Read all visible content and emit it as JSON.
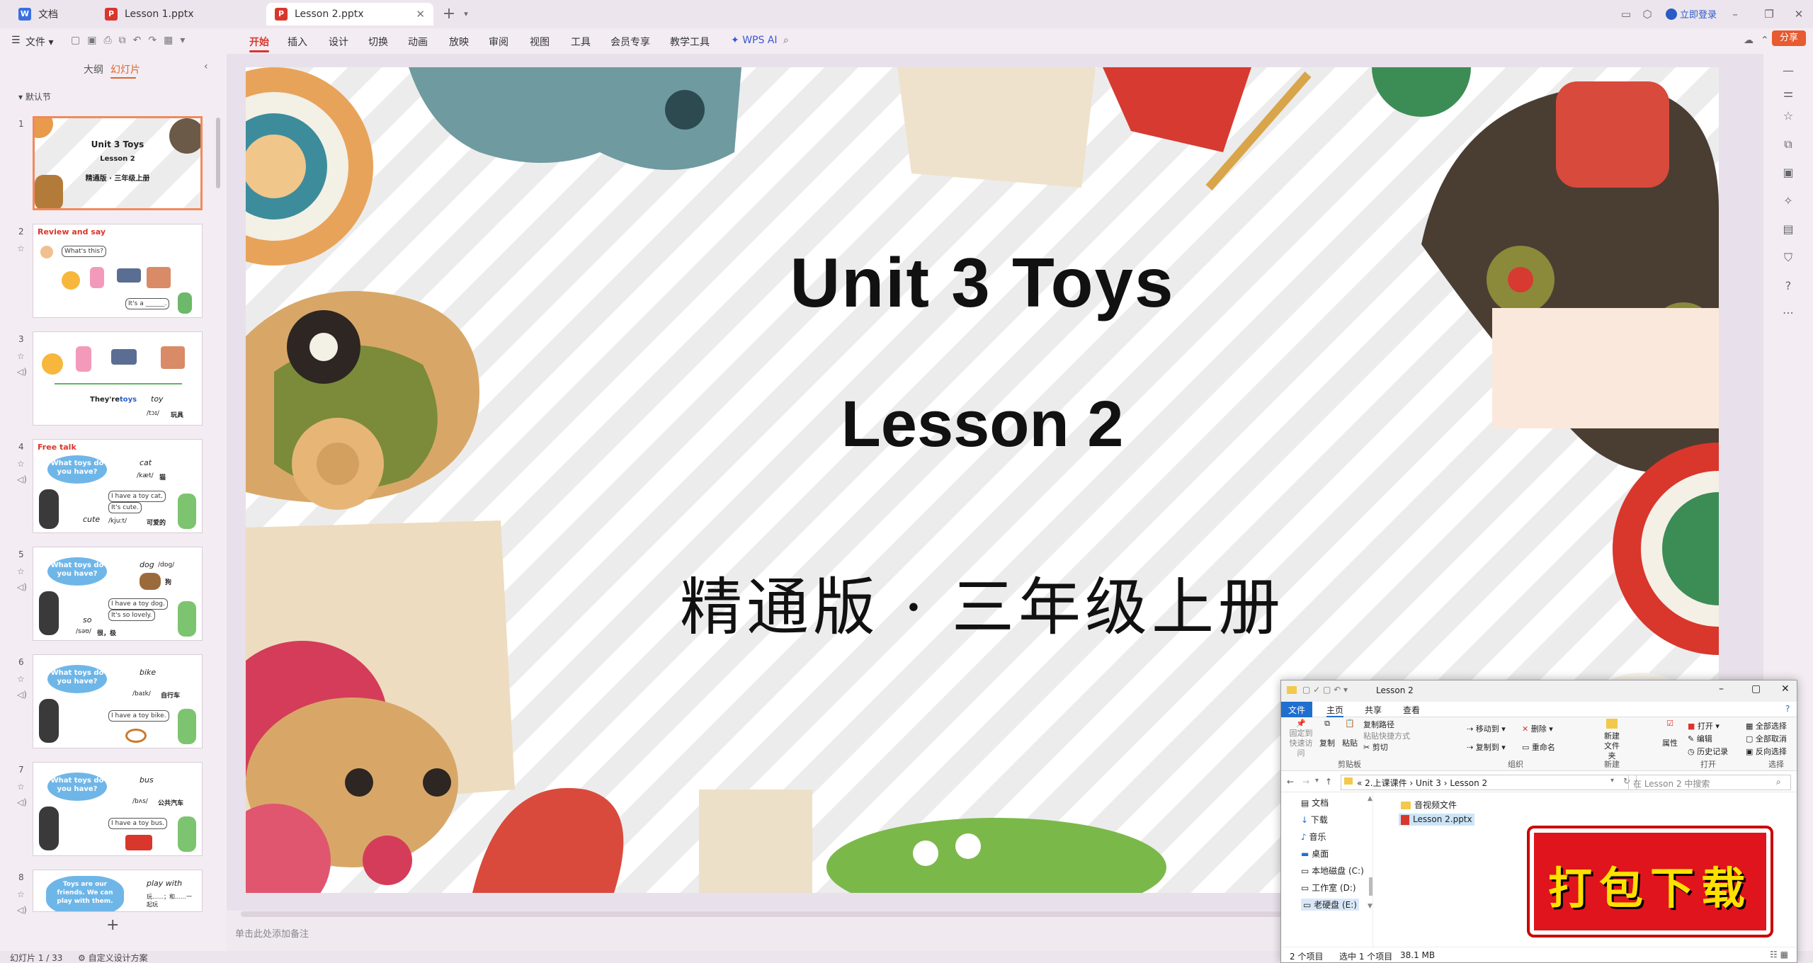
{
  "titlebar": {
    "tabs": [
      {
        "label": "文档",
        "icon": "document-icon"
      },
      {
        "label": "Lesson 1.pptx",
        "icon": "ppt-file-icon"
      },
      {
        "label": "Lesson 2.pptx",
        "icon": "ppt-file-icon"
      }
    ],
    "login_label": "立即登录"
  },
  "ribbon": {
    "file_label": "文件",
    "menu": [
      "开始",
      "插入",
      "设计",
      "切换",
      "动画",
      "放映",
      "审阅",
      "视图",
      "工具",
      "会员专享",
      "教学工具"
    ],
    "active_tab": "开始",
    "wps_ai": "WPS AI",
    "share_label": "分享"
  },
  "left_panel": {
    "tab_outline": "大纲",
    "tab_slides": "幻灯片",
    "section": "默认节",
    "slides": [
      {
        "num": "1",
        "line1": "Unit 3  Toys",
        "line2": "Lesson 2",
        "line3": "精通版 · 三年级上册"
      },
      {
        "num": "2",
        "header": "Review and say",
        "q": "What's this?",
        "a": "It's a ______."
      },
      {
        "num": "3",
        "text1": "They're",
        "text2": "toys",
        "text3": "toy",
        "text4": "/tɔɪ/",
        "text5": "玩具"
      },
      {
        "num": "4",
        "header": "Free talk",
        "q": "What toys do you have?",
        "word": "cat",
        "ipa": "/kæt/",
        "cn": "猫",
        "a1": "I have a toy cat.",
        "a2": "It's cute.",
        "word2": "cute",
        "ipa2": "/kjuːt/",
        "cn2": "可爱的"
      },
      {
        "num": "5",
        "q": "What toys do you have?",
        "word": "dog",
        "ipa": "/dɒg/",
        "cn": "狗",
        "a1": "I have a toy dog.",
        "a2": "It's so lovely.",
        "word2": "so",
        "ipa2": "/səʊ/",
        "cn2": "很，极"
      },
      {
        "num": "6",
        "q": "What toys do you have?",
        "word": "bike",
        "ipa": "/baɪk/",
        "cn": "自行车",
        "a1": "I have a toy bike."
      },
      {
        "num": "7",
        "q": "What toys do you have?",
        "word": "bus",
        "ipa": "/bʌs/",
        "cn": "公共汽车",
        "a1": "I have a toy bus."
      },
      {
        "num": "8",
        "q": "Toys are our friends. We can play with them.",
        "word": "play with",
        "cn": "玩……；和……一起玩"
      }
    ],
    "add_label": "+"
  },
  "slide": {
    "title": "Unit 3  Toys",
    "subtitle": "Lesson 2",
    "edition": "精通版 · 三年级上册"
  },
  "notes_placeholder": "单击此处添加备注",
  "statusbar": {
    "slide_info": "幻灯片 1 / 33",
    "design_label": "自定义设计方案"
  },
  "explorer": {
    "title": "Lesson 2",
    "tabs": [
      "文件",
      "主页",
      "共享",
      "查看"
    ],
    "clipboard": {
      "pin": "固定到快速访问",
      "copy": "复制",
      "paste": "粘贴",
      "copy_path": "复制路径",
      "paste_shortcut": "粘贴快捷方式",
      "cut": "剪切",
      "caption": "剪贴板"
    },
    "organize": {
      "move_to": "移动到",
      "copy_to": "复制到",
      "delete": "删除",
      "rename": "重命名",
      "caption": "组织"
    },
    "new": {
      "new_folder": "新建文件夹",
      "caption": "新建"
    },
    "open": {
      "properties": "属性",
      "open": "打开",
      "edit": "编辑",
      "history": "历史记录",
      "caption": "打开"
    },
    "select": {
      "select_all": "全部选择",
      "select_none": "全部取消",
      "invert": "反向选择",
      "caption": "选择"
    },
    "breadcrumb": [
      "2.上课课件",
      "Unit 3",
      "Lesson 2"
    ],
    "search_placeholder": "在 Lesson 2 中搜索",
    "nav": [
      "文档",
      "下载",
      "音乐",
      "桌面",
      "本地磁盘 (C:)",
      "工作室 (D:)",
      "老硬盘 (E:)"
    ],
    "files": [
      {
        "name": "音视频文件",
        "type": "folder"
      },
      {
        "name": "Lesson 2.pptx",
        "type": "pptx"
      }
    ],
    "status_count": "2 个项目",
    "status_selected": "选中 1 个项目",
    "status_size": "38.1 MB"
  },
  "banner": {
    "text": "打包下载"
  }
}
